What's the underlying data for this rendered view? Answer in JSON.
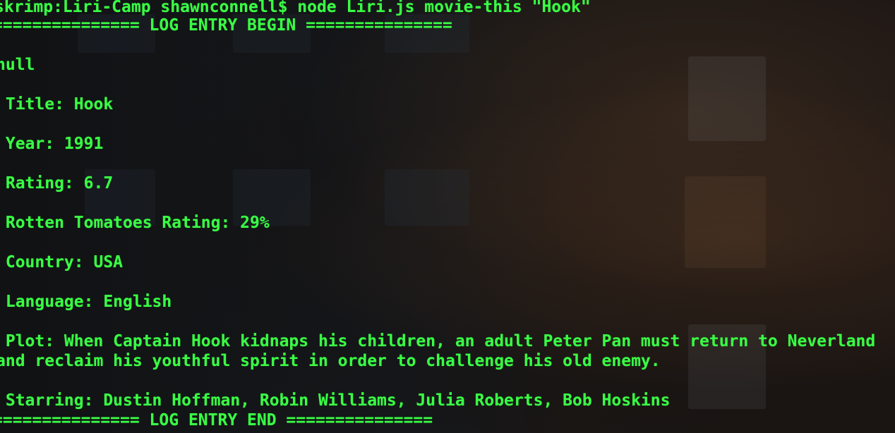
{
  "terminal": {
    "prompt": "skrimp:Liri-Camp shawnconnell$ node Liri.js movie-this \"Hook\"",
    "log_begin": "=============== LOG ENTRY BEGIN ===============",
    "null_line": "null",
    "title": " Title: Hook",
    "year": " Year: 1991",
    "rating": " Rating: 6.7",
    "rotten_tomatoes": " Rotten Tomatoes Rating: 29%",
    "country": " Country: USA",
    "language": " Language: English",
    "plot_line1": " Plot: When Captain Hook kidnaps his children, an adult Peter Pan must return to Neverland",
    "plot_line2": "and reclaim his youthful spirit in order to challenge his old enemy.",
    "starring": " Starring: Dustin Hoffman, Robin Williams, Julia Roberts, Bob Hoskins",
    "log_end": "=============== LOG ENTRY END ==============="
  },
  "colors": {
    "text": "#39ff44",
    "background": "#0f0f10"
  }
}
